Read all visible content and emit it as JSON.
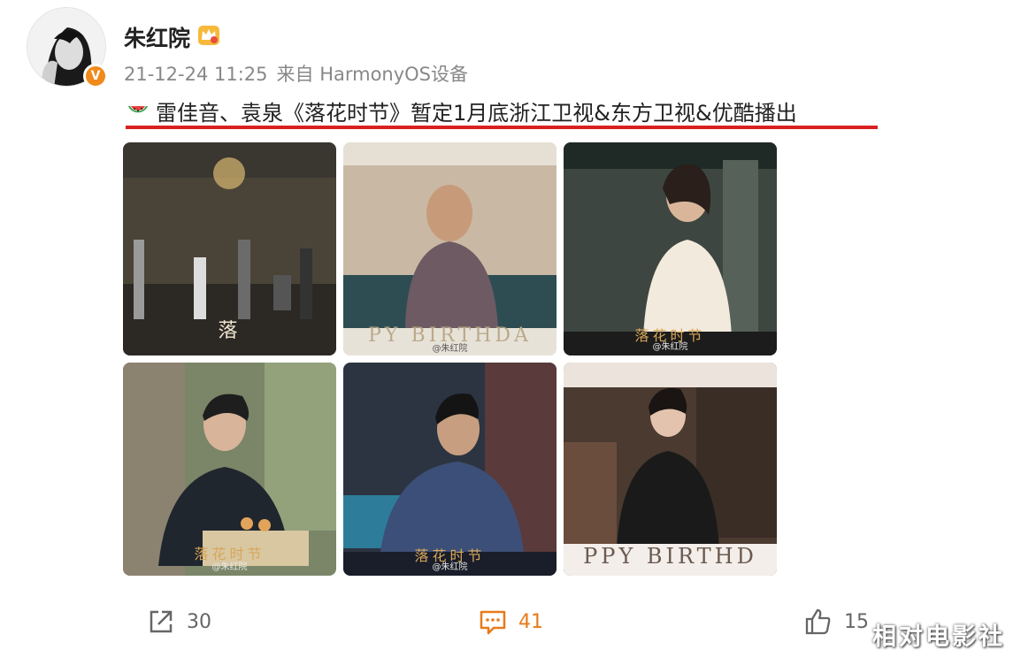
{
  "post": {
    "author": "朱红院",
    "timestamp": "21-12-24 11:25",
    "source": "来自 HarmonyOS设备",
    "text": "雷佳音、袁泉《落花时节》暂定1月底浙江卫视&东方卫视&优酷播出",
    "verified_badge": "V",
    "icons": {
      "verified": "verified-badge-icon",
      "member": "crown-icon",
      "emoji": "watermelon-icon"
    }
  },
  "photos": [
    {
      "overlay": "落",
      "credit": ""
    },
    {
      "overlay": "PY BIRTHDA",
      "credit": "@朱红院"
    },
    {
      "overlay": "落花时节",
      "credit": "@朱红院"
    },
    {
      "overlay": "落花时节",
      "credit": "@朱红院"
    },
    {
      "overlay": "落花时节",
      "credit": "@朱红院"
    },
    {
      "overlay": "PPY BIRTHD",
      "credit": ""
    }
  ],
  "actions": {
    "share_count": "30",
    "comment_count": "41",
    "like_count": "15",
    "icons": {
      "share": "share-icon",
      "comment": "comment-icon",
      "like": "thumbs-up-icon"
    }
  },
  "watermark": "相对电影社",
  "colors": {
    "underline": "#d9201f",
    "comment_accent": "#e87a1a",
    "verified": "#f08a1b"
  }
}
